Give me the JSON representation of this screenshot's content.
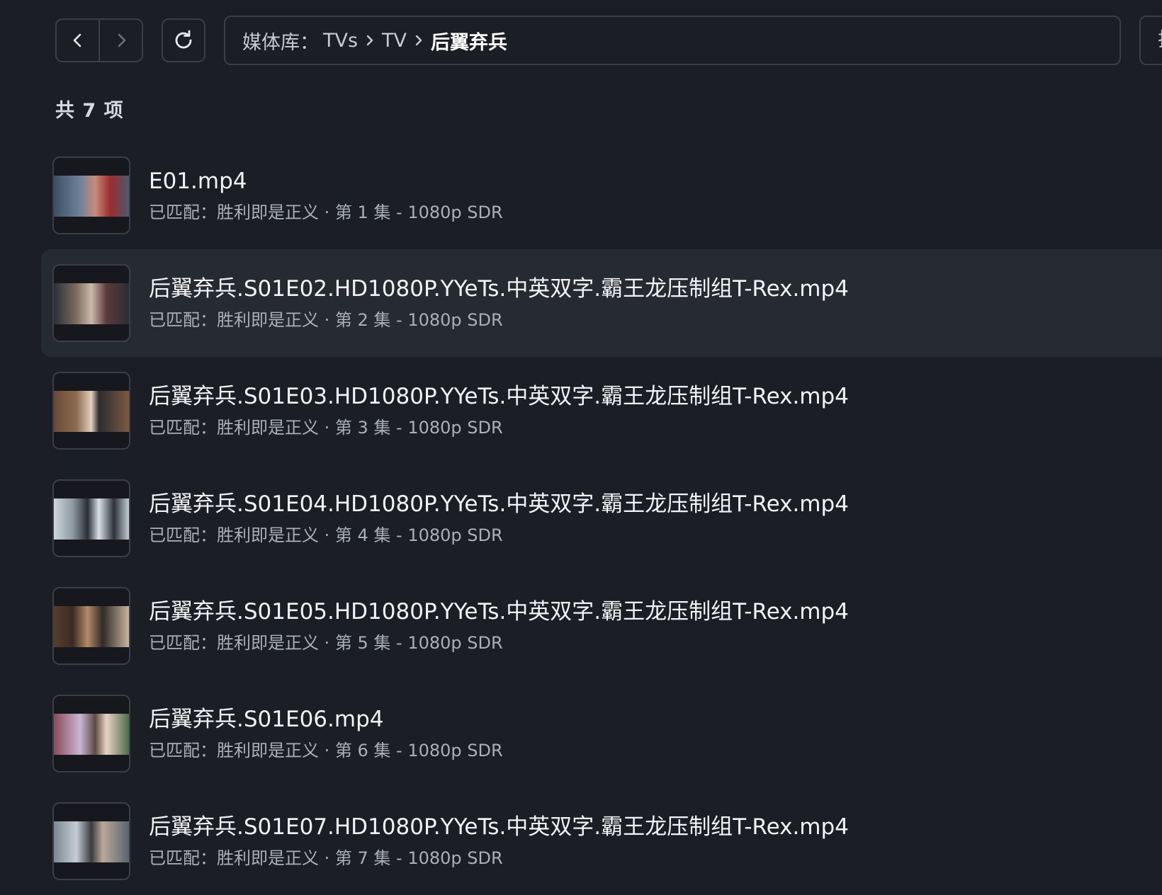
{
  "toolbar": {
    "back_icon": "chevron-left-icon",
    "forward_icon": "chevron-right-icon",
    "refresh_icon": "refresh-icon",
    "breadcrumb": {
      "prefix": "媒体库：",
      "items": [
        "TVs",
        "TV",
        "后翼弃兵"
      ]
    },
    "edge_text": "排"
  },
  "summary": {
    "count_label": "共 7 项"
  },
  "files": [
    {
      "title": "E01.mp4",
      "meta": "已匹配：胜利即是正义 · 第 1 集 - 1080p SDR"
    },
    {
      "title": "后翼弃兵.S01E02.HD1080P.YYeTs.中英双字.霸王龙压制组T-Rex.mp4",
      "meta": "已匹配：胜利即是正义 · 第 2 集 - 1080p SDR"
    },
    {
      "title": "后翼弃兵.S01E03.HD1080P.YYeTs.中英双字.霸王龙压制组T-Rex.mp4",
      "meta": "已匹配：胜利即是正义 · 第 3 集 - 1080p SDR"
    },
    {
      "title": "后翼弃兵.S01E04.HD1080P.YYeTs.中英双字.霸王龙压制组T-Rex.mp4",
      "meta": "已匹配：胜利即是正义 · 第 4 集 - 1080p SDR"
    },
    {
      "title": "后翼弃兵.S01E05.HD1080P.YYeTs.中英双字.霸王龙压制组T-Rex.mp4",
      "meta": "已匹配：胜利即是正义 · 第 5 集 - 1080p SDR"
    },
    {
      "title": "后翼弃兵.S01E06.mp4",
      "meta": "已匹配：胜利即是正义 · 第 6 集 - 1080p SDR"
    },
    {
      "title": "后翼弃兵.S01E07.HD1080P.YYeTs.中英双字.霸王龙压制组T-Rex.mp4",
      "meta": "已匹配：胜利即是正义 · 第 7 集 - 1080p SDR"
    }
  ],
  "colors": {
    "background": "#1b1e24",
    "selected_row": "#262a31",
    "border": "#3a3f47"
  }
}
